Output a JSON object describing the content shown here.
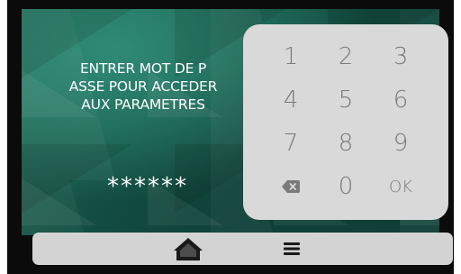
{
  "screen": {
    "message_lines": [
      "ENTRER MOT DE P",
      "ASSE POUR ACCEDER",
      "AUX PARAMETRES"
    ],
    "password_mask": "******"
  },
  "keypad": {
    "keys": [
      "1",
      "2",
      "3",
      "4",
      "5",
      "6",
      "7",
      "8",
      "9",
      "0",
      "OK"
    ],
    "backspace_icon": "backspace-icon"
  },
  "navbar": {
    "home_icon": "home-icon",
    "menu_icon": "menu-icon"
  },
  "colors": {
    "background": "#1f6e5b",
    "keypad": "#d9d9d9",
    "key_text": "#7a7a7a",
    "navbar": "#d3d3d3",
    "icon": "#1a1a1a"
  }
}
